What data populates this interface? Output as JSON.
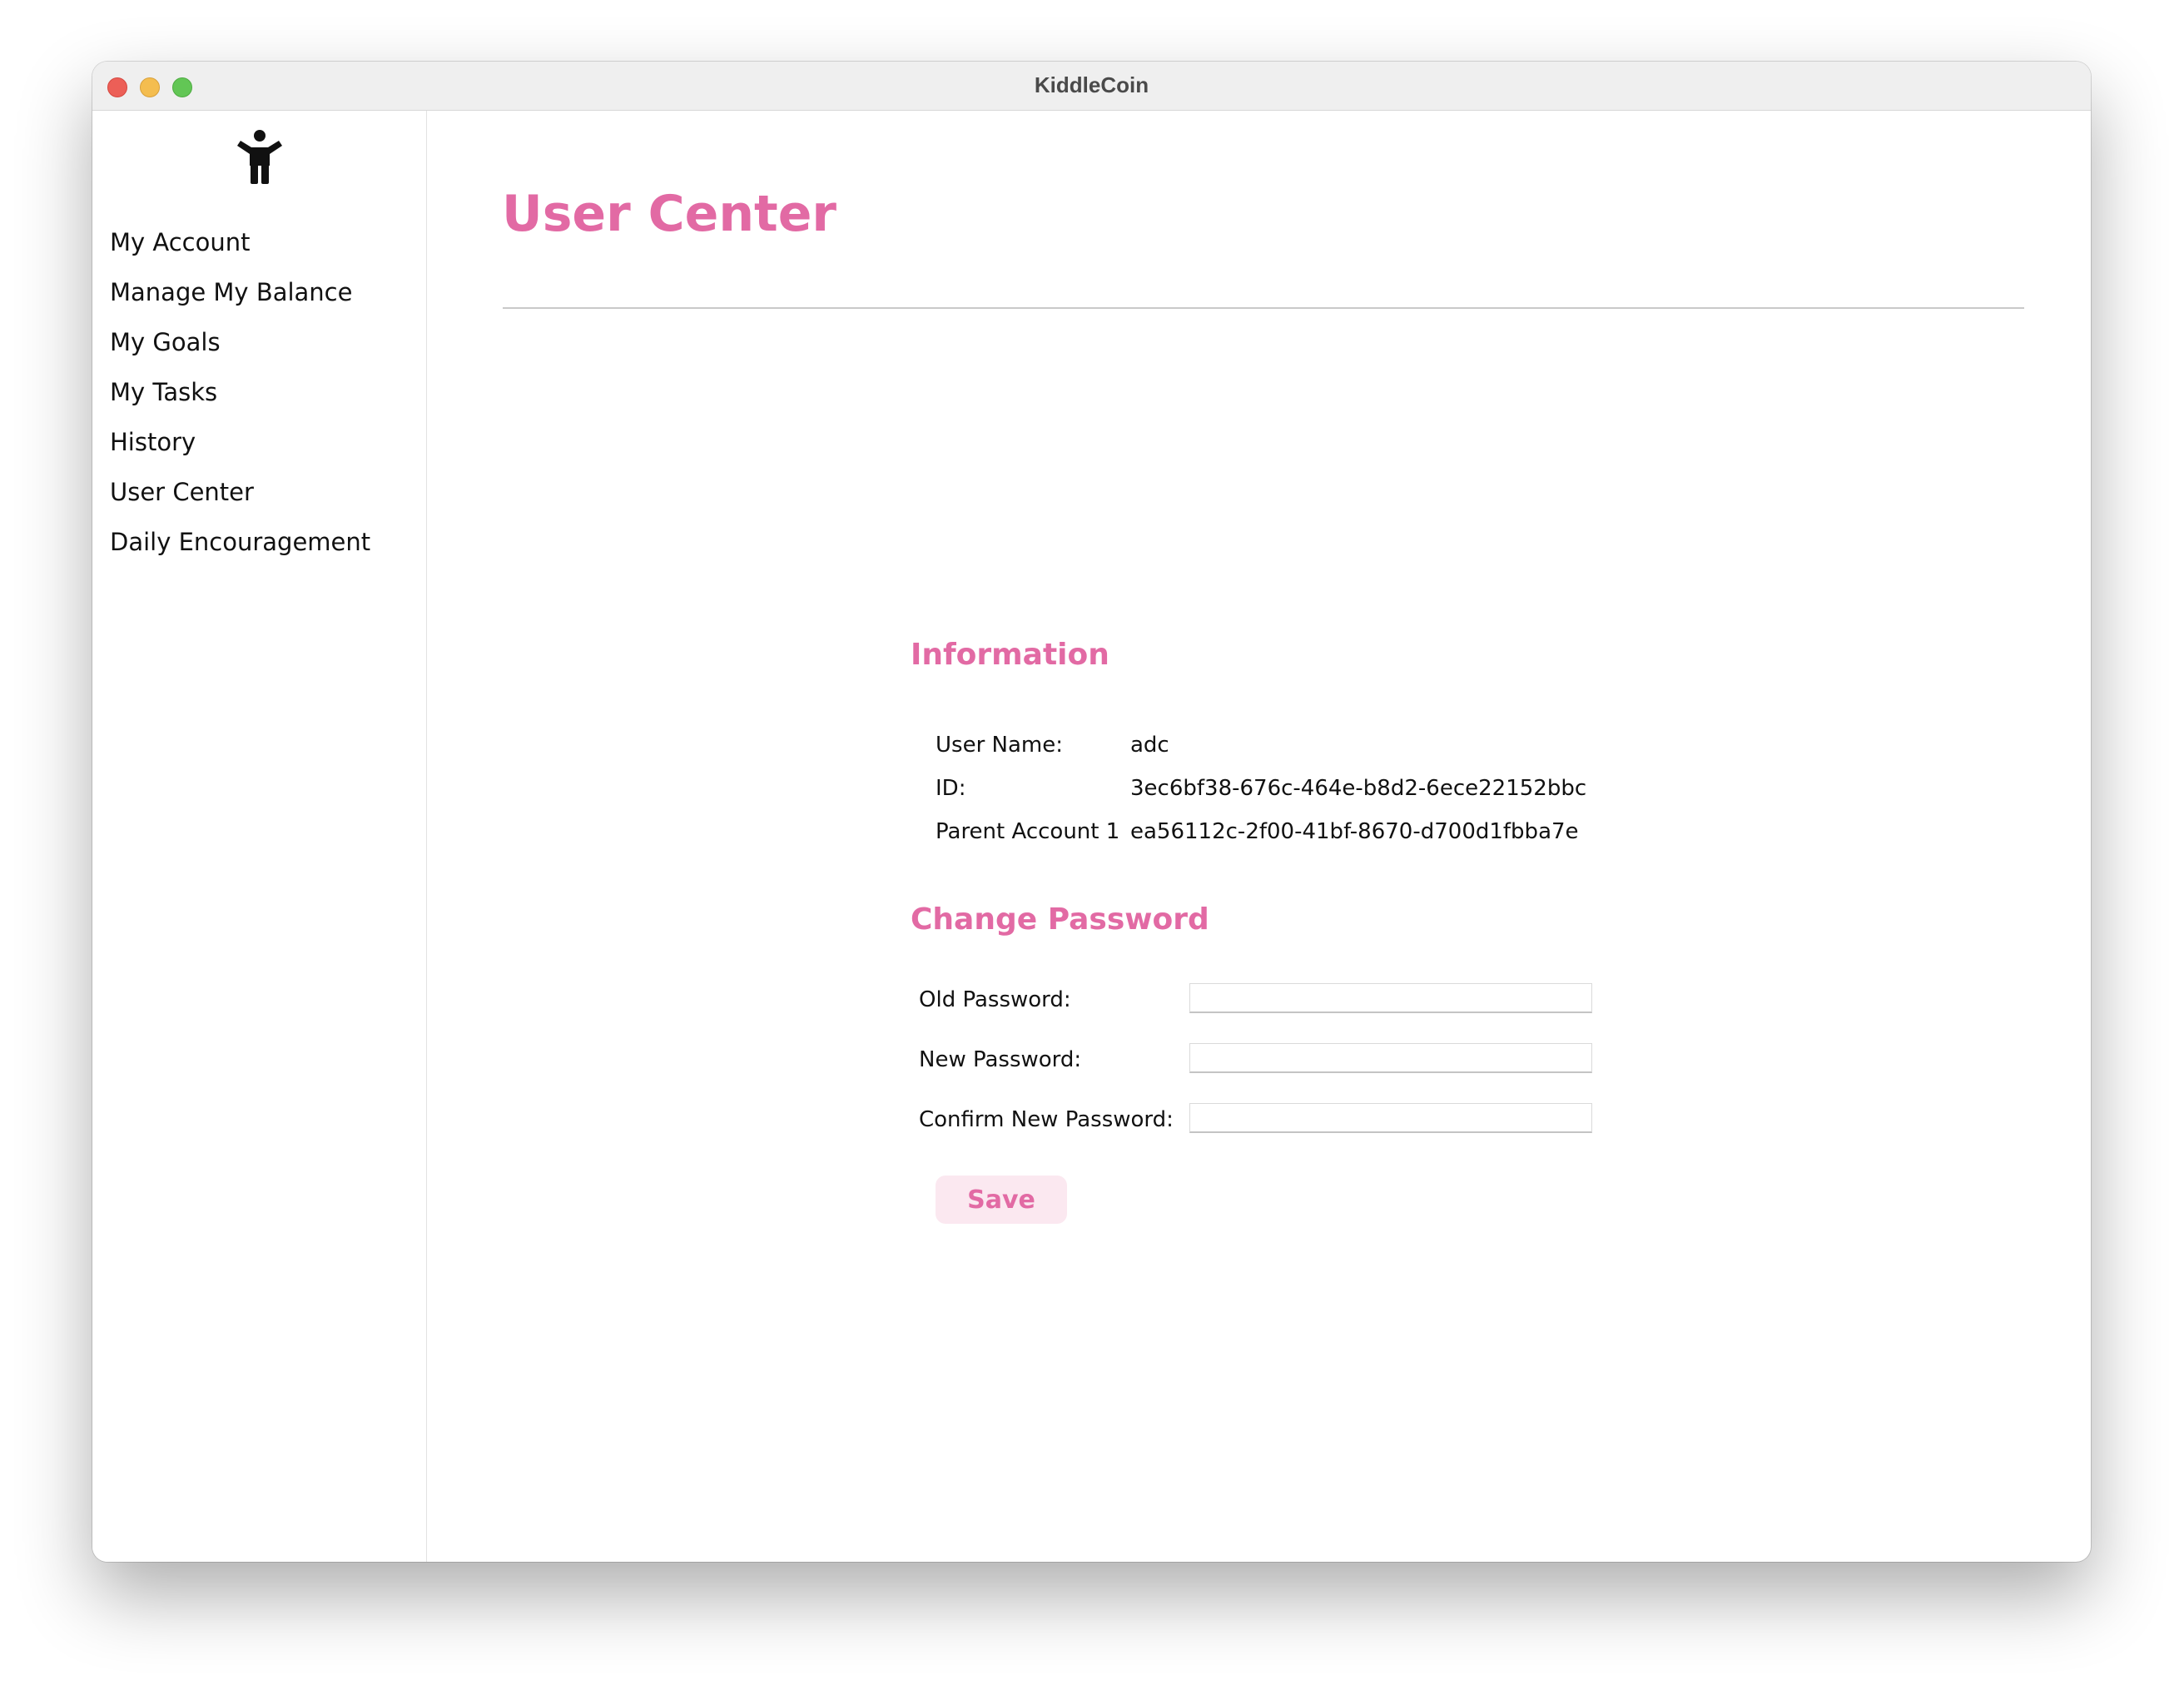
{
  "window": {
    "title": "KiddleCoin"
  },
  "sidebar": {
    "logo_icon": "child-figure-icon",
    "items": [
      {
        "label": "My Account"
      },
      {
        "label": "Manage My Balance"
      },
      {
        "label": "My Goals"
      },
      {
        "label": "My Tasks"
      },
      {
        "label": "History"
      },
      {
        "label": "User Center"
      },
      {
        "label": "Daily Encouragement"
      }
    ]
  },
  "main": {
    "title": "User Center",
    "information": {
      "heading": "Information",
      "rows": [
        {
          "label": "User Name:",
          "value": "adc"
        },
        {
          "label": "ID:",
          "value": "3ec6bf38-676c-464e-b8d2-6ece22152bbc"
        },
        {
          "label": "Parent Account 1",
          "value": "ea56112c-2f00-41bf-8670-d700d1fbba7e"
        }
      ]
    },
    "change_password": {
      "heading": "Change Password",
      "old_label": "Old Password:",
      "old_value": "",
      "new_label": "New Password:",
      "new_value": "",
      "confirm_label": "Confirm New Password:",
      "confirm_value": "",
      "save_label": "Save"
    }
  },
  "colors": {
    "accent": "#e26aa4",
    "button_bg": "#fbe8f0",
    "traffic_close": "#ec5f57",
    "traffic_min": "#f4bd4f",
    "traffic_max": "#62c655"
  }
}
